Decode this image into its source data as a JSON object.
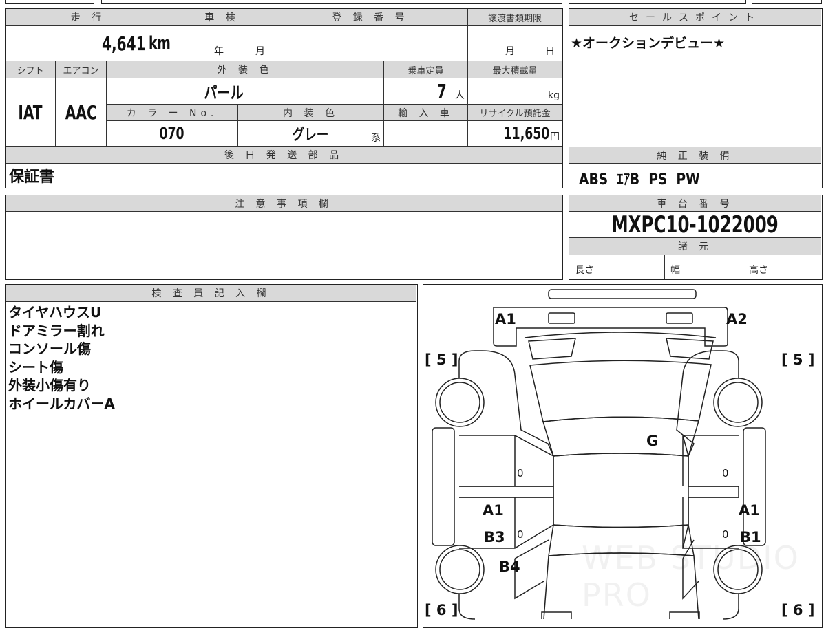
{
  "vehicle": {
    "mileage_header": "走 行",
    "mileage": "4,641",
    "mileage_unit": "km",
    "inspection_header": "車 検",
    "inspection_year_unit": "年",
    "inspection_month_unit": "月",
    "registration_header": "登 録 番 号",
    "transfer_deadline_header": "譲渡書類期限",
    "transfer_month_unit": "月",
    "transfer_day_unit": "日",
    "shift_header": "シフト",
    "shift": "IAT",
    "ac_header": "エアコン",
    "ac": "AAC",
    "exterior_color_header": "外 装 色",
    "exterior_color": "パール",
    "capacity_header": "乗車定員",
    "capacity": "7",
    "capacity_unit": "人",
    "max_load_header": "最大積載量",
    "max_load_unit": "kg",
    "color_no_header": "カ ラ ー No.",
    "color_no": "070",
    "interior_color_header": "内 装 色",
    "interior_color": "グレー",
    "interior_color_suffix": "系",
    "import_header": "輸 入 車",
    "recycle_header": "リサイクル預託金",
    "recycle_fee": "11,650",
    "recycle_unit": "円",
    "later_parts_header": "後 日 発 送 部 品",
    "later_parts": "保証書"
  },
  "sales_point": {
    "header": "セールスポイント",
    "text": "★オークションデビュー★"
  },
  "equipment": {
    "header": "純 正 装 備",
    "text": "ABS  ｴｱB  PS  PW"
  },
  "notes": {
    "header": "注 意 事 項 欄"
  },
  "chassis": {
    "header": "車 台 番 号",
    "number": "MXPC10-1022009",
    "specs_header": "諸 元",
    "length_label": "長さ",
    "width_label": "幅",
    "height_label": "高さ"
  },
  "inspector": {
    "header": "検 査 員 記 入 欄",
    "lines": [
      "タイヤハウスU",
      "ドアミラー割れ",
      "コンソール傷",
      "シート傷",
      "外装小傷有り",
      "ホイールカバーA"
    ]
  },
  "diagram": {
    "marks": {
      "front_left": "A1",
      "front_right": "A2",
      "tire_fl": "[ 5 ]",
      "tire_fr": "[ 5 ]",
      "tire_rl": "[ 6 ]",
      "tire_rr": "[ 6 ]",
      "roof": "G",
      "left_front_door": "0",
      "right_front_door": "0",
      "left_rear_door_a": "A1",
      "left_rear_door_b": "B3",
      "left_rear_door_c": "0",
      "right_rear_door_a": "A1",
      "right_rear_door_b": "B1",
      "right_rear_door_c": "0",
      "left_rear_fender": "B4"
    },
    "watermark": "WEB STUDIO PRO"
  }
}
